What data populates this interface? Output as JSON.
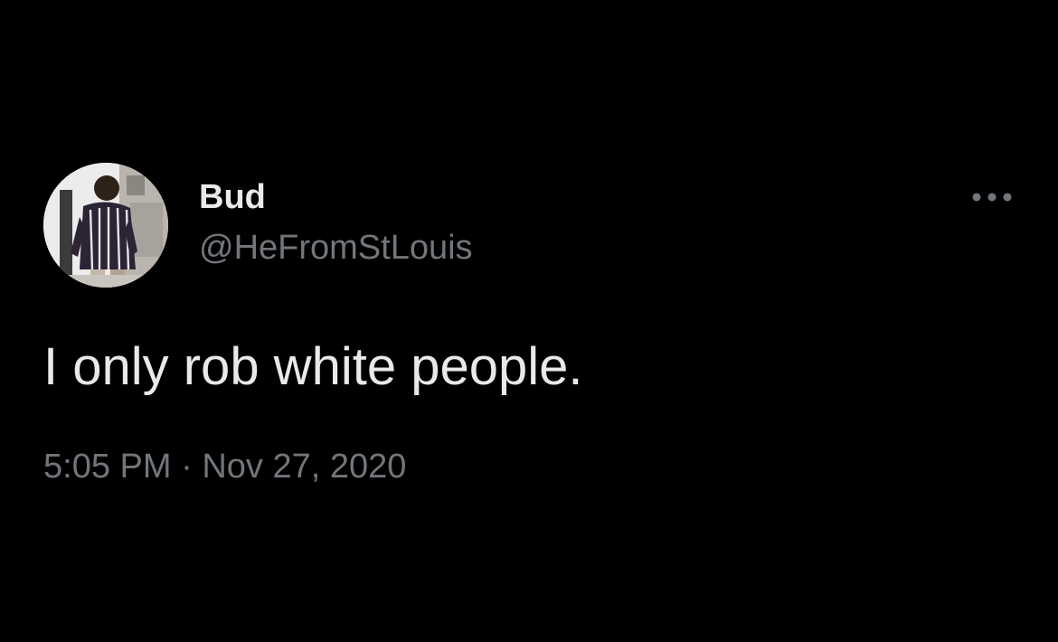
{
  "tweet": {
    "author": {
      "display_name": "Bud",
      "handle": "@HeFromStLouis",
      "avatar_icon": "user-photo"
    },
    "text": "I only rob white people.",
    "time": "5:05 PM",
    "separator": " · ",
    "date": "Nov 27, 2020",
    "more_icon": "more-horizontal-icon"
  },
  "colors": {
    "background": "#000000",
    "primary_text": "#e7e9ea",
    "secondary_text": "#71767b"
  }
}
